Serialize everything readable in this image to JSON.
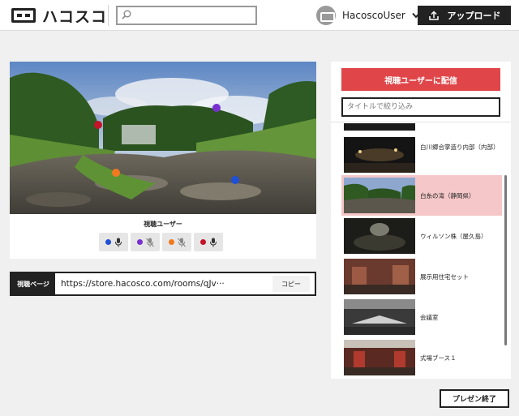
{
  "header": {
    "logo_text": "ハコスコ",
    "search": {
      "value": "",
      "placeholder": ""
    },
    "user_name": "HacoscoUser",
    "upload_label": "アップロード"
  },
  "viewer": {
    "section_label": "視聴ユーザー",
    "users": [
      {
        "color": "#1f4fd6",
        "mic": "mic-icon"
      },
      {
        "color": "#7a2fd1",
        "mic": "mic-off-icon"
      },
      {
        "color": "#ef7a1f",
        "mic": "mic-off-icon"
      },
      {
        "color": "#c4142a",
        "mic": "mic-icon"
      }
    ]
  },
  "share": {
    "label": "視聴ページ",
    "url": "https://store.hacosco.com/rooms/qJv···",
    "copy_label": "コピー"
  },
  "panel": {
    "broadcast_label": "視聴ユーザーに配信",
    "filter_placeholder": "タイトルで絞り込み",
    "rooms": [
      {
        "name": "白川郷合掌造り内部（内部）"
      },
      {
        "name": "白糸の滝（静岡県）",
        "selected": true
      },
      {
        "name": "ウィルソン株（屋久島）"
      },
      {
        "name": "展示用住宅セット"
      },
      {
        "name": "会議室"
      },
      {
        "name": "式場ブース１"
      }
    ]
  },
  "footer": {
    "end_label": "プレゼン終了"
  },
  "colors": {
    "accent": "#e04649",
    "selected_row": "#f5c7c8",
    "dark": "#222222"
  }
}
